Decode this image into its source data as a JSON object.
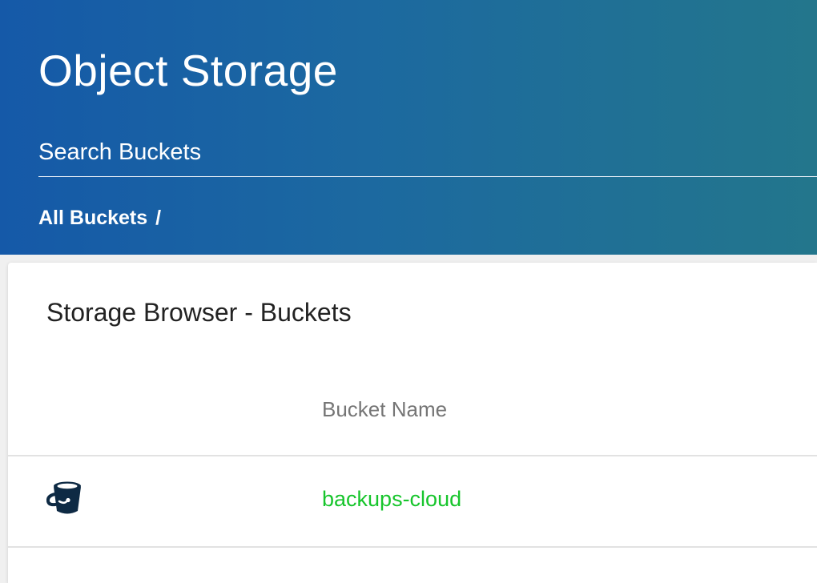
{
  "header": {
    "title": "Object Storage",
    "search_placeholder": "Search Buckets",
    "breadcrumb": {
      "root_label": "All Buckets",
      "separator": "/"
    }
  },
  "card": {
    "title": "Storage Browser - Buckets",
    "columns": [
      "Bucket Name"
    ],
    "rows": [
      {
        "icon": "bucket-icon",
        "name": "backups-cloud"
      }
    ]
  },
  "colors": {
    "header_gradient_start": "#1559a8",
    "header_gradient_end": "#23768c",
    "link": "#17c52c",
    "icon": "#0e2a44"
  }
}
